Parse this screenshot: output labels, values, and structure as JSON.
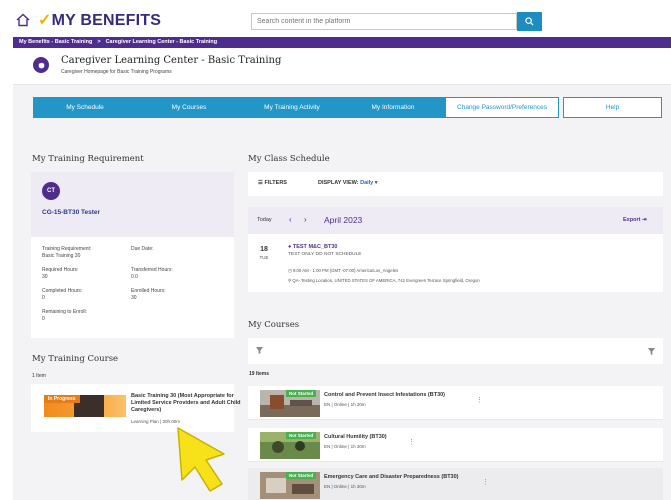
{
  "header": {
    "logo_prefix": "MY BENEFITS",
    "search_placeholder": "Search content in the platform"
  },
  "breadcrumb": {
    "item1": "My Benefits - Basic Training",
    "separator": ">",
    "item2": "Caregiver Learning Center - Basic Training"
  },
  "title": {
    "main": "Caregiver Learning Center - Basic Training",
    "sub": "Caregiver Homepage for Basic Training Programs"
  },
  "nav": [
    "My Schedule",
    "My Courses",
    "My Training Activity",
    "My Information",
    "Change Password/Preferences",
    "Help"
  ],
  "requirement": {
    "heading": "My Training Requirement",
    "avatar": "CT",
    "name": "CG-15-BT30 Tester",
    "training_req_label": "Training Requirement:",
    "training_req_value": "Basic Training 30",
    "due_label": "Due Date:",
    "required_label": "Required Hours:",
    "required_value": "30",
    "transferred_label": "Transferred Hours:",
    "transferred_value": "0.0",
    "completed_label": "Completed Hours:",
    "completed_value": "0",
    "enrolled_label": "Enrolled Hours:",
    "enrolled_value": "30",
    "remaining_label": "Remaining to Enroll:",
    "remaining_value": "0"
  },
  "training_course": {
    "heading": "My Training Course",
    "count": "1 Item",
    "status": "In Progress",
    "title": "Basic Training 30 (Most Appropriate for Limited Service Providers and Adult Child Caregivers)",
    "meta": "Learning Plan  |  30h 00m"
  },
  "schedule": {
    "heading": "My Class Schedule",
    "filters": "FILTERS",
    "display_label": "DISPLAY VIEW:",
    "display_value": "Daily",
    "today": "Today",
    "month": "April 2023",
    "export": "Export",
    "day": "18",
    "dow": "TUE",
    "event_title": "TEST M&C_BT30",
    "event_sub": "TEST ONLY DO NOT SCHEDULE",
    "event_time": "9:00 AM - 1:00 PM (GMT -07:00) America/Los_Angeles",
    "event_location": "QA- Testing Location, UNITED STATES OF AMERICA, 742 Evergreen Terrace Springfield, Oregon"
  },
  "courses": {
    "heading": "My Courses",
    "count": "19 Items",
    "items": [
      {
        "status": "Not Started",
        "title": "Control and Prevent Insect Infestations (BT30)",
        "meta": "EN  |  Online  |  1h 30m"
      },
      {
        "status": "Not Started",
        "title": "Cultural Humility (BT30)",
        "meta": "EN  |  Online  |  1h 30m"
      },
      {
        "status": "Not Started",
        "title": "Emergency Care and Disaster Preparedness (BT30)",
        "meta": "EN  |  Online  |  1h 30m"
      }
    ]
  },
  "colors": {
    "brand_purple": "#4f2d8e",
    "nav_blue": "#2196c7",
    "not_started_green": "#4caf50",
    "in_progress_orange": "#e87c14",
    "cursor_yellow": "#f7e21a"
  }
}
